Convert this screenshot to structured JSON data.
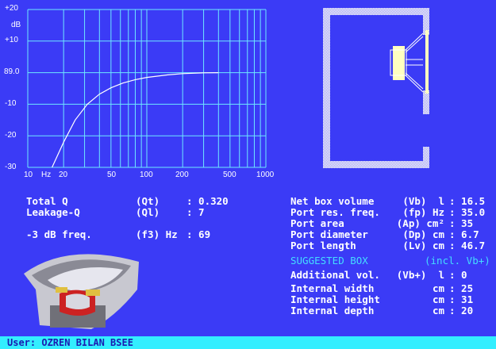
{
  "chart_data": {
    "type": "line",
    "title": "",
    "ylabel": "dB",
    "xlabel": "Hz",
    "xscale": "log",
    "xlim": [
      10,
      1000
    ],
    "ylim": [
      -30,
      20
    ],
    "y_ticks": [
      "+20",
      "+10",
      "89.0",
      "-10",
      "-20",
      "-30"
    ],
    "x_ticks": [
      "10",
      "20",
      "50",
      "100",
      "200",
      "500",
      "1000"
    ],
    "grid": true,
    "x": [
      16,
      20,
      25,
      31.6,
      40,
      50,
      63,
      80,
      100,
      150,
      200,
      300,
      400
    ],
    "y": [
      -30,
      -22,
      -15,
      -10,
      -6.8,
      -4.8,
      -3.3,
      -2.2,
      -1.5,
      -0.7,
      -0.3,
      -0.05,
      0
    ]
  },
  "colors": {
    "background": "#3b3bf6",
    "grid": "#6ee8ff",
    "footer": "#33eeff",
    "accent": "#44ddff"
  },
  "params_left": [
    {
      "label": "Total Q",
      "unit": "(Qt)",
      "value": ": 0.320"
    },
    {
      "label": "Leakage-Q",
      "unit": "(Ql)",
      "value": ": 7"
    },
    {
      "label": "-3 dB freq.",
      "unit": "(f3) Hz",
      "value": ": 69"
    }
  ],
  "params_right": [
    {
      "label": "Net box volume",
      "unit": "(Vb)  l",
      "value": ": 16.5"
    },
    {
      "label": "Port res. freq.",
      "unit": "(fp) Hz",
      "value": ": 35.0"
    },
    {
      "label": "Port area",
      "unit": "(Ap) cm²",
      "value": ": 35"
    },
    {
      "label": "Port diameter",
      "unit": "(Dp) cm",
      "value": ": 6.7"
    },
    {
      "label": "Port length",
      "unit": "(Lv) cm",
      "value": ": 46.7"
    }
  ],
  "suggested": {
    "title": "SUGGESTED BOX",
    "note": "(incl. Vb+)"
  },
  "box_params": [
    {
      "label": "Additional vol.",
      "unit": "(Vb+)  l",
      "value": ": 0"
    },
    {
      "label": "Internal width",
      "unit": "cm",
      "value": ": 25"
    },
    {
      "label": "Internal height",
      "unit": "cm",
      "value": ": 31"
    },
    {
      "label": "Internal depth",
      "unit": "cm",
      "value": ": 20"
    }
  ],
  "footer": {
    "user": "User: OZREN BILAN BSEE"
  }
}
